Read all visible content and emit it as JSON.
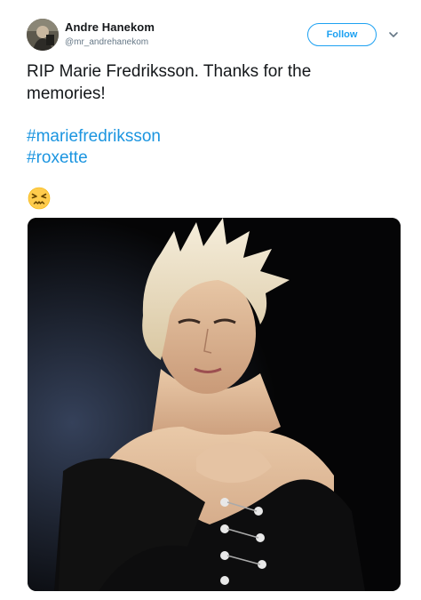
{
  "user": {
    "name": "Andre Hanekom",
    "handle": "@mr_andrehanekom"
  },
  "follow_button": {
    "label": "Follow"
  },
  "tweet": {
    "text_line1": "RIP Marie Fredriksson. Thanks for the",
    "text_line2": "memories!",
    "hashtags": [
      "#mariefredriksson",
      "#roxette"
    ],
    "emoji": "persevering-face-emoji"
  },
  "colors": {
    "accent": "#1da1f2",
    "link": "#1b95e0",
    "text": "#14171a",
    "secondary": "#657786"
  }
}
